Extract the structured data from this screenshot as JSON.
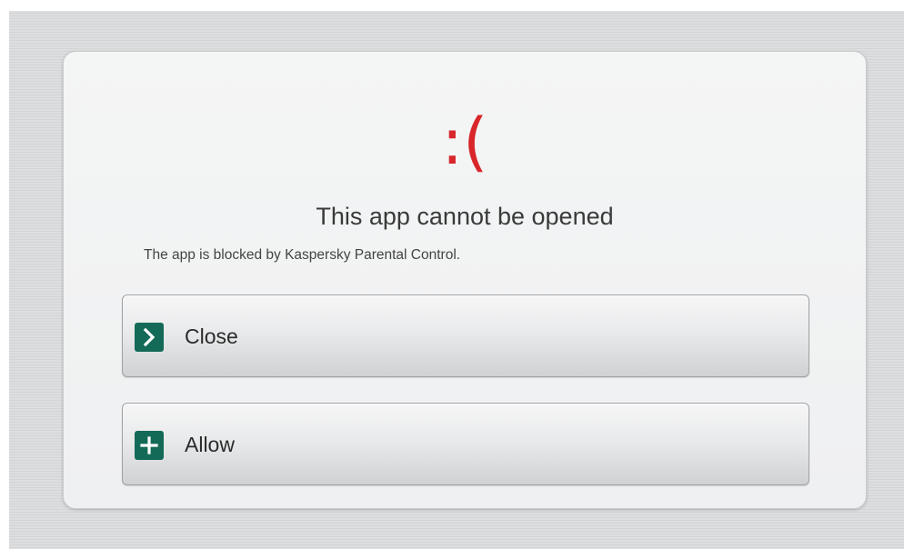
{
  "dialog": {
    "icon_glyph": ":(",
    "icon_name": "sad-face-icon",
    "title": "This app cannot be opened",
    "message": "The app is blocked by Kaspersky Parental Control.",
    "buttons": {
      "close": {
        "label": "Close",
        "icon": "chevron-right-icon"
      },
      "allow": {
        "label": "Allow",
        "icon": "plus-icon"
      }
    }
  },
  "colors": {
    "accent_red": "#d8262a",
    "icon_green": "#136a57",
    "text_dark": "#3a3a3a",
    "dialog_background": "#f0f1f1",
    "screen_background": "#d9dbdc"
  }
}
